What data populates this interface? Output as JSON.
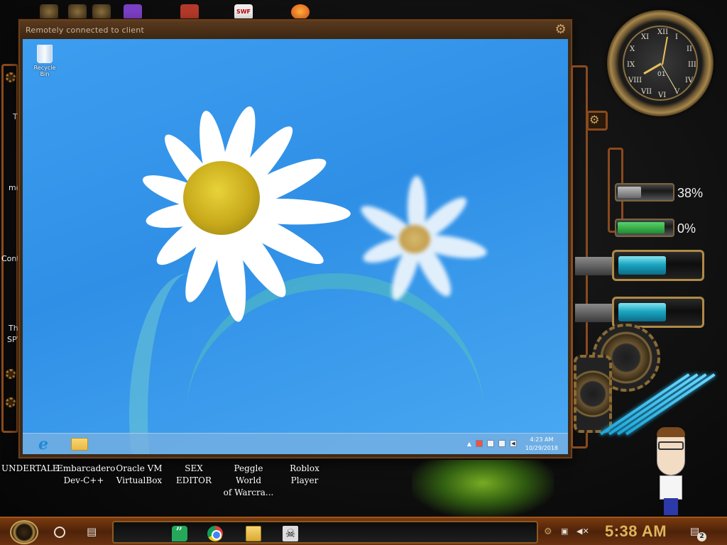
{
  "remote_window": {
    "title": "Remotely connected to client",
    "recycle_bin_label": "Recycle Bin",
    "clock_time": "4:23 AM",
    "clock_date": "10/29/2018"
  },
  "desktop_icons": [
    {
      "line1": "UNDERTALE",
      "line2": ""
    },
    {
      "line1": "Embarcadero",
      "line2": "Dev-C++"
    },
    {
      "line1": "Oracle VM",
      "line2": "VirtualBox"
    },
    {
      "line1": "SEX",
      "line2": "EDITOR"
    },
    {
      "line1": "Peggle World",
      "line2": "of Warcra..."
    },
    {
      "line1": "Roblox Player",
      "line2": ""
    }
  ],
  "left_fragments": [
    "T",
    "mo",
    "Cont",
    "Th",
    "SPY"
  ],
  "top_icons": [
    "swf-label"
  ],
  "top_icon_text": "SWF",
  "widgets": {
    "clock_date_numeral": "01",
    "meter_1_percent": "38%",
    "meter_1_value": 0.38,
    "meter_2_percent": "0%",
    "meter_2_value": 0.0,
    "tube_1_level": 0.6,
    "tube_2_level": 0.6
  },
  "taskbar": {
    "clock": "5:38 AM",
    "notification_count": "2",
    "apps": [
      "hangouts-icon",
      "chrome-icon",
      "file-explorer-icon",
      "skull-app-icon"
    ]
  },
  "colors": {
    "remote_wallpaper": "#3d9ef0",
    "taskbar_copper": "#7a3a0e",
    "clock_text": "#e0b45a",
    "meter_green": "#2fbf4a",
    "tube_cyan": "#1ba6c2"
  }
}
